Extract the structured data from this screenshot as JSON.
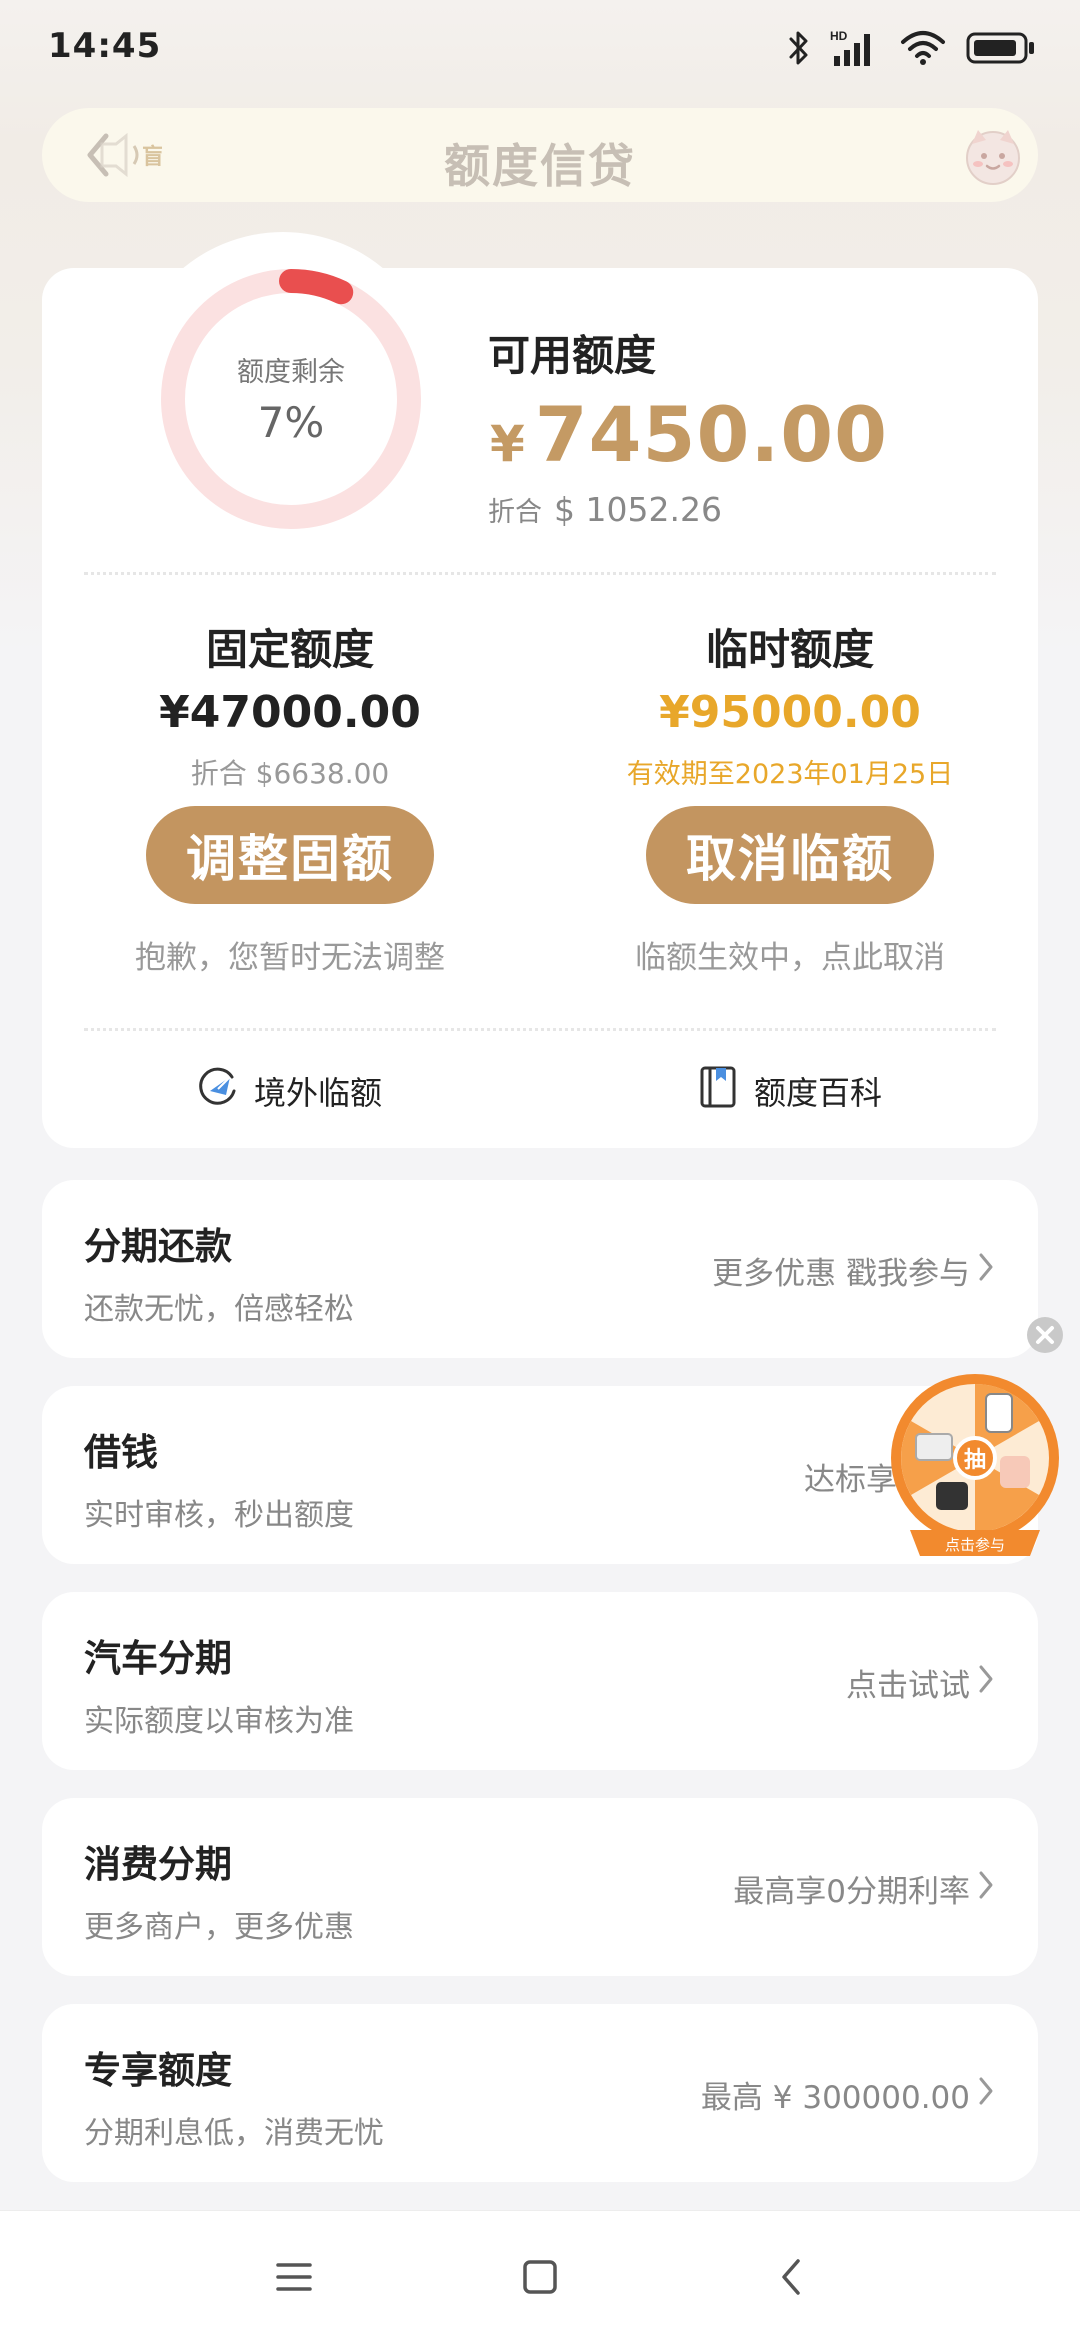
{
  "status_bar": {
    "time": "14:45",
    "icons": [
      "bluetooth-icon",
      "hd-signal-icon",
      "wifi-icon",
      "battery-icon"
    ],
    "hd_label": "HD"
  },
  "header": {
    "title": "额度信贷",
    "back_icon": "back-arrow-icon",
    "sound_icon": "speaker-icon",
    "mascot_icon": "mascot-icon"
  },
  "quota_card": {
    "ring": {
      "label": "额度剩余",
      "value": "7%",
      "remaining_fraction": 0.07,
      "track_color": "#fbe1e1",
      "fill_color": "#e94f4f"
    },
    "available": {
      "title": "可用额度",
      "currency": "¥",
      "amount": "7450.00",
      "usd_label": "折合",
      "usd_value": "$ 1052.26"
    },
    "fixed": {
      "title": "固定额度",
      "amount": "¥47000.00",
      "usd": "折合 $6638.00",
      "button_label": "调整固额",
      "note": "抱歉，您暂时无法调整"
    },
    "temporary": {
      "title": "临时额度",
      "amount": "¥95000.00",
      "validity": "有效期至2023年01月25日",
      "button_label": "取消临额",
      "note": "临额生效中，点此取消"
    },
    "links": [
      {
        "label": "境外临额",
        "icon": "plane-globe-icon"
      },
      {
        "label": "额度百科",
        "icon": "book-icon"
      }
    ]
  },
  "services": [
    {
      "title": "分期还款",
      "subtitle": "还款无忧，倍感轻松",
      "action": "更多优惠 戳我参与"
    },
    {
      "title": "借钱",
      "subtitle": "实时审核，秒出额度",
      "action": "达标享好"
    },
    {
      "title": "汽车分期",
      "subtitle": "实际额度以审核为准",
      "action": "点击试试"
    },
    {
      "title": "消费分期",
      "subtitle": "更多商户，更多优惠",
      "action": "最高享0分期利率"
    },
    {
      "title": "专享额度",
      "subtitle": "分期利息低，消费无忧",
      "action": "最高 ¥ 300000.00"
    }
  ],
  "floating_promo": {
    "center_label": "抽",
    "caption": "点击参与",
    "close_icon": "close-icon"
  },
  "nav_bar": {
    "buttons": [
      "menu-icon",
      "home-icon",
      "back-icon"
    ]
  },
  "colors": {
    "accent": "#c39560",
    "gold_text": "#c49a64",
    "highlight": "#e8a72a",
    "ring_red": "#e94f4f"
  }
}
